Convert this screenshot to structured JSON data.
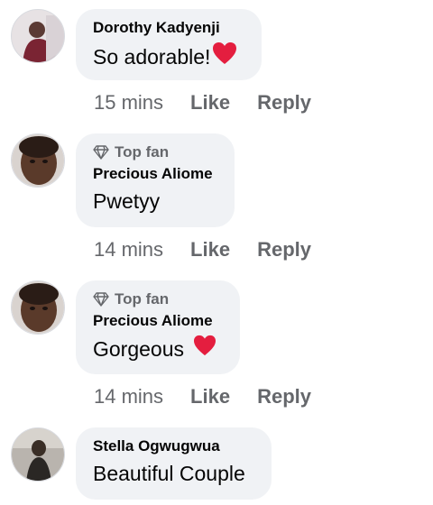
{
  "comments": [
    {
      "name": "Dorothy Kadyenji",
      "text": "So adorable!",
      "heart": true,
      "time": "15 mins",
      "like": "Like",
      "reply": "Reply"
    },
    {
      "badge": "Top fan",
      "name": "Precious Aliome",
      "text": "Pwetyy",
      "time": "14 mins",
      "like": "Like",
      "reply": "Reply"
    },
    {
      "badge": "Top fan",
      "name": "Precious Aliome",
      "text": "Gorgeous",
      "heart": true,
      "time": "14 mins",
      "like": "Like",
      "reply": "Reply"
    },
    {
      "name": "Stella Ogwugwua",
      "text": "Beautiful Couple"
    }
  ],
  "colors": {
    "bubble": "#f0f2f5",
    "meta": "#65676b",
    "heart": "#e41e3f"
  }
}
